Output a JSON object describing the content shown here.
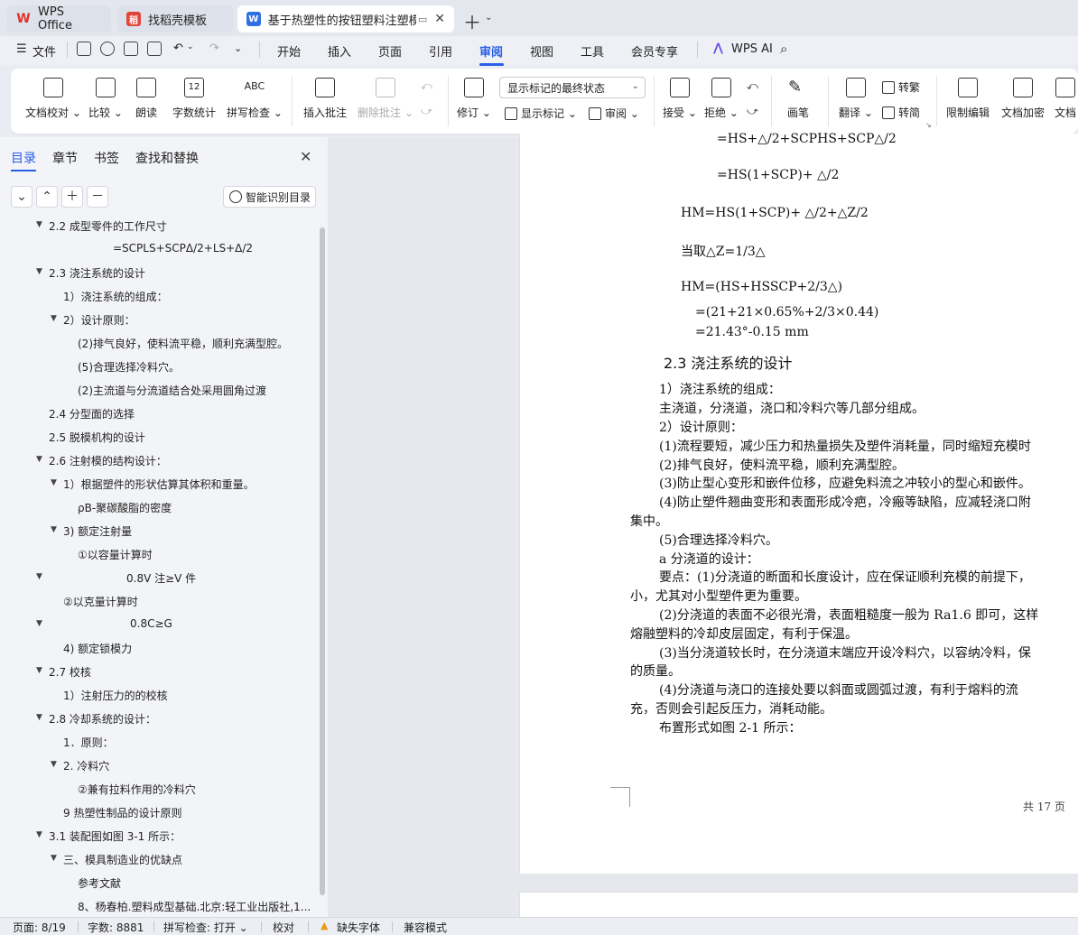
{
  "tabs": {
    "wps_office": "WPS Office",
    "daoke": "找稻壳模板",
    "document": "基于热塑性的按钮塑料注塑模具"
  },
  "menu": {
    "file": "文件",
    "items": [
      "开始",
      "插入",
      "页面",
      "引用",
      "审阅",
      "视图",
      "工具",
      "会员专享"
    ],
    "active": "审阅",
    "wps_ai": "WPS AI"
  },
  "ribbon": {
    "doc_proof": "文档校对",
    "compare": "比较",
    "read_aloud": "朗读",
    "word_count": "字数统计",
    "spell_check": "拼写检查",
    "spell_icon_text": "ABC",
    "word_count_icon_text": "12",
    "insert_comment": "插入批注",
    "delete_comment": "删除批注",
    "revise": "修订",
    "display_state": "显示标记的最终状态",
    "show_marks": "显示标记",
    "review": "审阅",
    "accept": "接受",
    "reject": "拒绝",
    "pen": "画笔",
    "translate": "翻译",
    "to_traditional": "转繁",
    "to_simplified": "转简",
    "restrict_edit": "限制编辑",
    "doc_encrypt": "文档加密",
    "doc_more": "文档"
  },
  "left_panel": {
    "tabs": [
      "目录",
      "章节",
      "书签",
      "查找和替换"
    ],
    "active_tab": "目录",
    "smart_toc": "智能识别目录",
    "toc": [
      {
        "text": "2.2  成型零件的工作尺寸",
        "expanded": true
      },
      {
        "text": "=SCPLS+SCPΔ/2+LS+Δ/2",
        "expanded": null
      },
      {
        "text": "2.3  浇注系统的设计",
        "expanded": true
      },
      {
        "text": "1）浇注系统的组成：",
        "expanded": null
      },
      {
        "text": "2）设计原则：",
        "expanded": true
      },
      {
        "text": "(2)排气良好，使料流平稳，顺利充满型腔。",
        "expanded": null
      },
      {
        "text": "(5)合理选择冷料穴。",
        "expanded": null
      },
      {
        "text": "(2)主流道与分流道结合处采用圆角过渡",
        "expanded": null
      },
      {
        "text": "2.4  分型面的选择",
        "expanded": null
      },
      {
        "text": "2.5  脱模机构的设计",
        "expanded": null
      },
      {
        "text": "2.6  注射模的结构设计：",
        "expanded": true
      },
      {
        "text": "1）根据塑件的形状估算其体积和重量。",
        "expanded": true
      },
      {
        "text": "ρB-聚碳酸脂的密度",
        "expanded": null
      },
      {
        "text": "3)     额定注射量",
        "expanded": true
      },
      {
        "text": "①以容量计算时",
        "expanded": null
      },
      {
        "text": "0.8V 注≥V 件",
        "expanded": true
      },
      {
        "text": "②以克量计算时",
        "expanded": null
      },
      {
        "text": "0.8C≥G",
        "expanded": true
      },
      {
        "text": "4)     额定锁模力",
        "expanded": null
      },
      {
        "text": "2.7 校核",
        "expanded": true
      },
      {
        "text": "1）注射压力的的校核",
        "expanded": null
      },
      {
        "text": "2.8  冷却系统的设计：",
        "expanded": true
      },
      {
        "text": "1．原则：",
        "expanded": null
      },
      {
        "text": "2. 冷料穴",
        "expanded": true
      },
      {
        "text": "②兼有拉料作用的冷料穴",
        "expanded": null
      },
      {
        "text": "9 热塑性制品的设计原则",
        "expanded": null
      },
      {
        "text": "3.1 装配图如图 3-1 所示：",
        "expanded": true
      },
      {
        "text": "三、模具制造业的优缺点",
        "expanded": true
      },
      {
        "text": "参考文献",
        "expanded": null
      },
      {
        "text": "8、杨春柏.塑料成型基础.北京:轻工业出版社,1...",
        "expanded": null
      }
    ]
  },
  "document": {
    "formulas": [
      "=HS+△/2+SCPHS+SCP△/2",
      "=HS(1+SCP)+ △/2",
      "HM=HS(1+SCP)+ △/2+△Z/2",
      "当取△Z=1/3△",
      "HM=(HS+HSSCP+2/3△)",
      "=(21+21×0.65%+2/3×0.44)",
      "=21.43°-0.15 mm"
    ],
    "heading": "2.3 浇注系统的设计",
    "paragraphs": [
      "1）浇注系统的组成：",
      "主浇道，分浇道，浇口和冷料穴等几部分组成。",
      "2）设计原则：",
      "(1)流程要短，减少压力和热量损失及塑件消耗量，同时缩短充模时",
      "(2)排气良好，使料流平稳，顺利充满型腔。",
      "(3)防止型心变形和嵌件位移，应避免料流之冲较小的型心和嵌件。",
      "(4)防止塑件翘曲变形和表面形成冷疤，冷瘢等缺陷，应减轻浇口附",
      "集中。",
      "(5)合理选择冷料穴。",
      "a 分浇道的设计：",
      "要点：(1)分浇道的断面和长度设计，应在保证顺利充模的前提下，",
      "小，尤其对小型塑件更为重要。",
      "(2)分浇道的表面不必很光滑，表面粗糙度一般为 Ra1.6 即可，这样",
      "熔融塑料的冷却皮层固定，有利于保温。",
      "(3)当分浇道较长时，在分浇道末端应开设冷料穴，以容纳冷料，保",
      "的质量。",
      "(4)分浇道与浇口的连接处要以斜面或圆弧过渡，有利于熔料的流",
      "充，否则会引起反压力，消耗动能。",
      "布置形式如图 2-1 所示："
    ],
    "page_count": "共 17 页"
  },
  "status": {
    "page": "页面: 8/19",
    "words": "字数: 8881",
    "spell": "拼写检查: 打开",
    "proof": "校对",
    "missing_font": "缺失字体",
    "compat": "兼容模式"
  }
}
